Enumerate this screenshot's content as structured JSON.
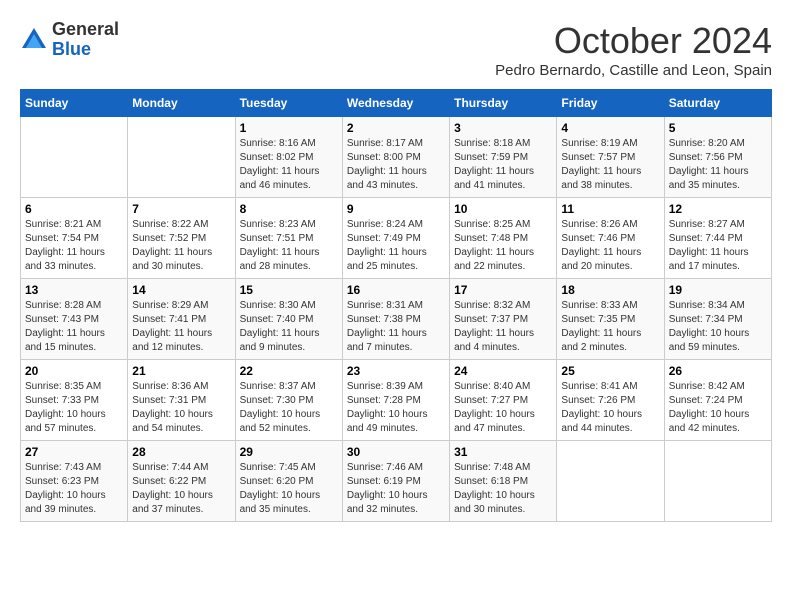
{
  "header": {
    "logo_general": "General",
    "logo_blue": "Blue",
    "title": "October 2024",
    "location": "Pedro Bernardo, Castille and Leon, Spain"
  },
  "calendar": {
    "days_of_week": [
      "Sunday",
      "Monday",
      "Tuesday",
      "Wednesday",
      "Thursday",
      "Friday",
      "Saturday"
    ],
    "weeks": [
      [
        {
          "day": "",
          "info": ""
        },
        {
          "day": "",
          "info": ""
        },
        {
          "day": "1",
          "info": "Sunrise: 8:16 AM\nSunset: 8:02 PM\nDaylight: 11 hours and 46 minutes."
        },
        {
          "day": "2",
          "info": "Sunrise: 8:17 AM\nSunset: 8:00 PM\nDaylight: 11 hours and 43 minutes."
        },
        {
          "day": "3",
          "info": "Sunrise: 8:18 AM\nSunset: 7:59 PM\nDaylight: 11 hours and 41 minutes."
        },
        {
          "day": "4",
          "info": "Sunrise: 8:19 AM\nSunset: 7:57 PM\nDaylight: 11 hours and 38 minutes."
        },
        {
          "day": "5",
          "info": "Sunrise: 8:20 AM\nSunset: 7:56 PM\nDaylight: 11 hours and 35 minutes."
        }
      ],
      [
        {
          "day": "6",
          "info": "Sunrise: 8:21 AM\nSunset: 7:54 PM\nDaylight: 11 hours and 33 minutes."
        },
        {
          "day": "7",
          "info": "Sunrise: 8:22 AM\nSunset: 7:52 PM\nDaylight: 11 hours and 30 minutes."
        },
        {
          "day": "8",
          "info": "Sunrise: 8:23 AM\nSunset: 7:51 PM\nDaylight: 11 hours and 28 minutes."
        },
        {
          "day": "9",
          "info": "Sunrise: 8:24 AM\nSunset: 7:49 PM\nDaylight: 11 hours and 25 minutes."
        },
        {
          "day": "10",
          "info": "Sunrise: 8:25 AM\nSunset: 7:48 PM\nDaylight: 11 hours and 22 minutes."
        },
        {
          "day": "11",
          "info": "Sunrise: 8:26 AM\nSunset: 7:46 PM\nDaylight: 11 hours and 20 minutes."
        },
        {
          "day": "12",
          "info": "Sunrise: 8:27 AM\nSunset: 7:44 PM\nDaylight: 11 hours and 17 minutes."
        }
      ],
      [
        {
          "day": "13",
          "info": "Sunrise: 8:28 AM\nSunset: 7:43 PM\nDaylight: 11 hours and 15 minutes."
        },
        {
          "day": "14",
          "info": "Sunrise: 8:29 AM\nSunset: 7:41 PM\nDaylight: 11 hours and 12 minutes."
        },
        {
          "day": "15",
          "info": "Sunrise: 8:30 AM\nSunset: 7:40 PM\nDaylight: 11 hours and 9 minutes."
        },
        {
          "day": "16",
          "info": "Sunrise: 8:31 AM\nSunset: 7:38 PM\nDaylight: 11 hours and 7 minutes."
        },
        {
          "day": "17",
          "info": "Sunrise: 8:32 AM\nSunset: 7:37 PM\nDaylight: 11 hours and 4 minutes."
        },
        {
          "day": "18",
          "info": "Sunrise: 8:33 AM\nSunset: 7:35 PM\nDaylight: 11 hours and 2 minutes."
        },
        {
          "day": "19",
          "info": "Sunrise: 8:34 AM\nSunset: 7:34 PM\nDaylight: 10 hours and 59 minutes."
        }
      ],
      [
        {
          "day": "20",
          "info": "Sunrise: 8:35 AM\nSunset: 7:33 PM\nDaylight: 10 hours and 57 minutes."
        },
        {
          "day": "21",
          "info": "Sunrise: 8:36 AM\nSunset: 7:31 PM\nDaylight: 10 hours and 54 minutes."
        },
        {
          "day": "22",
          "info": "Sunrise: 8:37 AM\nSunset: 7:30 PM\nDaylight: 10 hours and 52 minutes."
        },
        {
          "day": "23",
          "info": "Sunrise: 8:39 AM\nSunset: 7:28 PM\nDaylight: 10 hours and 49 minutes."
        },
        {
          "day": "24",
          "info": "Sunrise: 8:40 AM\nSunset: 7:27 PM\nDaylight: 10 hours and 47 minutes."
        },
        {
          "day": "25",
          "info": "Sunrise: 8:41 AM\nSunset: 7:26 PM\nDaylight: 10 hours and 44 minutes."
        },
        {
          "day": "26",
          "info": "Sunrise: 8:42 AM\nSunset: 7:24 PM\nDaylight: 10 hours and 42 minutes."
        }
      ],
      [
        {
          "day": "27",
          "info": "Sunrise: 7:43 AM\nSunset: 6:23 PM\nDaylight: 10 hours and 39 minutes."
        },
        {
          "day": "28",
          "info": "Sunrise: 7:44 AM\nSunset: 6:22 PM\nDaylight: 10 hours and 37 minutes."
        },
        {
          "day": "29",
          "info": "Sunrise: 7:45 AM\nSunset: 6:20 PM\nDaylight: 10 hours and 35 minutes."
        },
        {
          "day": "30",
          "info": "Sunrise: 7:46 AM\nSunset: 6:19 PM\nDaylight: 10 hours and 32 minutes."
        },
        {
          "day": "31",
          "info": "Sunrise: 7:48 AM\nSunset: 6:18 PM\nDaylight: 10 hours and 30 minutes."
        },
        {
          "day": "",
          "info": ""
        },
        {
          "day": "",
          "info": ""
        }
      ]
    ]
  }
}
